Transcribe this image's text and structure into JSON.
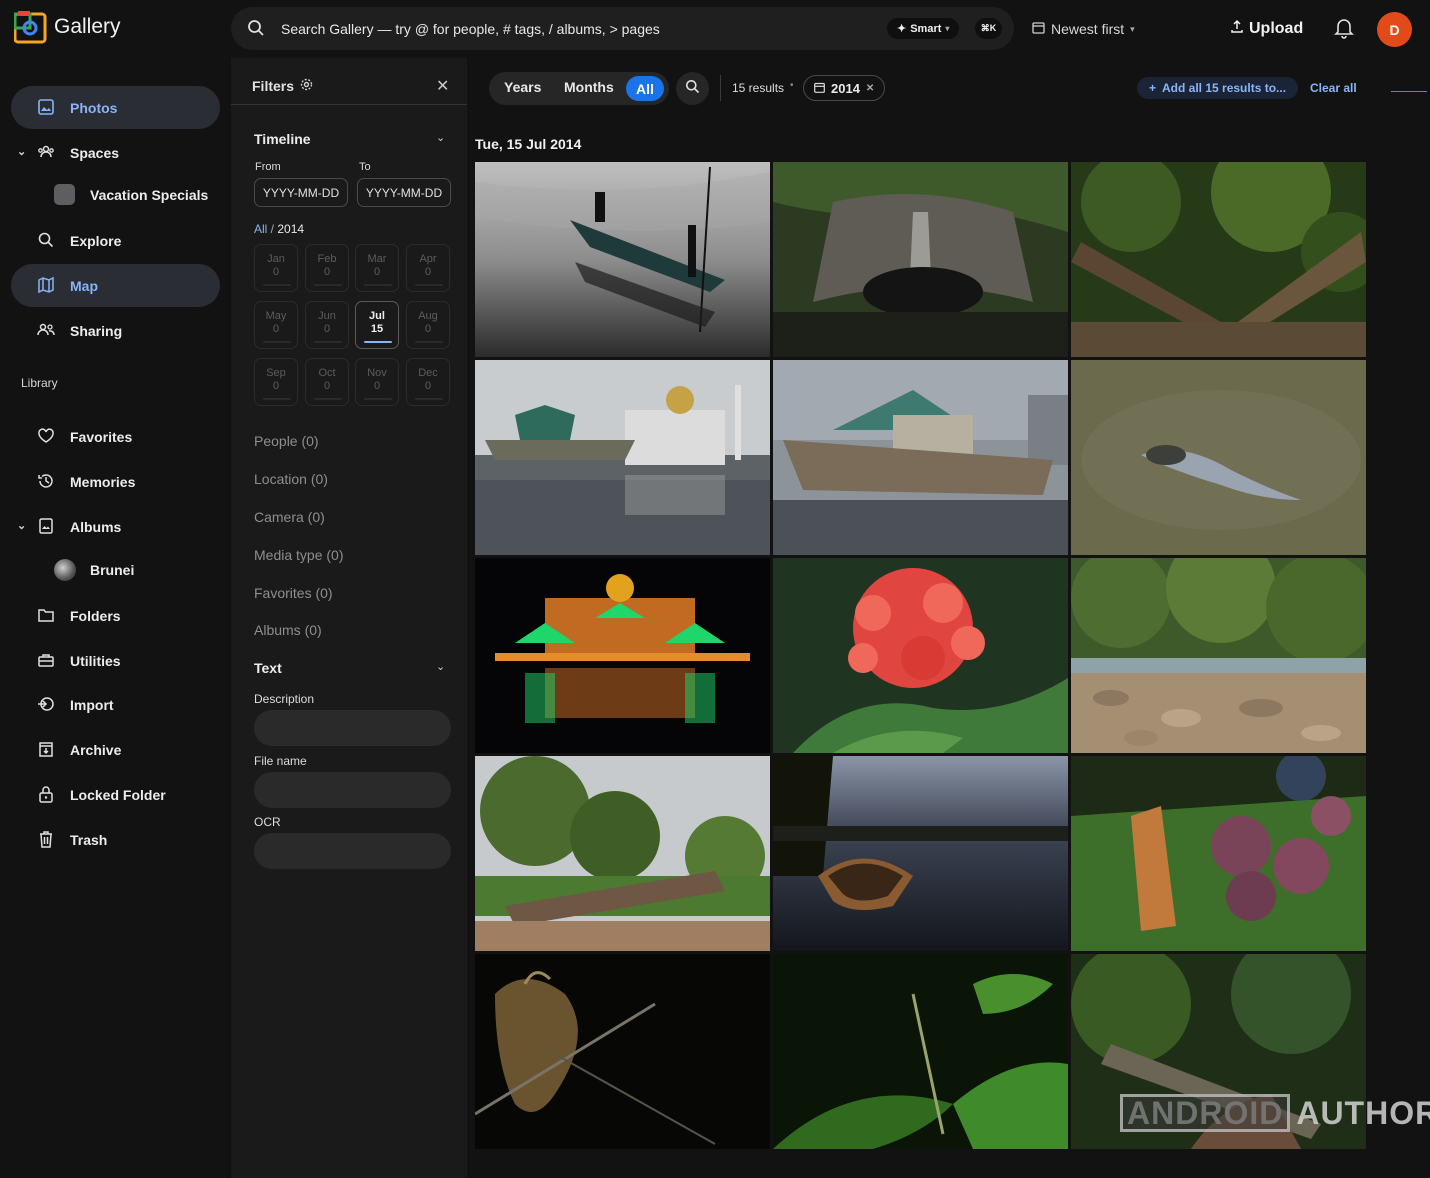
{
  "app": {
    "title": "Gallery"
  },
  "search": {
    "placeholder": "Search Gallery — try @ for people, # tags, / albums, > pages",
    "smart_label": "Smart",
    "shortcut": "⌘K"
  },
  "sort": {
    "label": "Newest first"
  },
  "upload": {
    "label": "Upload"
  },
  "user": {
    "initial": "D"
  },
  "sidebar": {
    "items": [
      {
        "label": "Photos"
      },
      {
        "label": "Spaces"
      },
      {
        "label": "Vacation Specials"
      },
      {
        "label": "Explore"
      },
      {
        "label": "Map"
      },
      {
        "label": "Sharing"
      }
    ],
    "library_label": "Library",
    "library_items": [
      {
        "label": "Favorites"
      },
      {
        "label": "Memories"
      },
      {
        "label": "Albums"
      },
      {
        "label": "Brunei"
      },
      {
        "label": "Folders"
      },
      {
        "label": "Utilities"
      },
      {
        "label": "Import"
      },
      {
        "label": "Archive"
      },
      {
        "label": "Locked Folder"
      },
      {
        "label": "Trash"
      }
    ]
  },
  "filters": {
    "title": "Filters",
    "timeline": {
      "title": "Timeline",
      "from_label": "From",
      "to_label": "To",
      "from_placeholder": "YYYY-MM-DD",
      "to_placeholder": "YYYY-MM-DD",
      "crumb_all": "All",
      "crumb_sep": " / ",
      "crumb_year": "2014",
      "months": [
        {
          "name": "Jan",
          "count": "0"
        },
        {
          "name": "Feb",
          "count": "0"
        },
        {
          "name": "Mar",
          "count": "0"
        },
        {
          "name": "Apr",
          "count": "0"
        },
        {
          "name": "May",
          "count": "0"
        },
        {
          "name": "Jun",
          "count": "0"
        },
        {
          "name": "Jul",
          "count": "15"
        },
        {
          "name": "Aug",
          "count": "0"
        },
        {
          "name": "Sep",
          "count": "0"
        },
        {
          "name": "Oct",
          "count": "0"
        },
        {
          "name": "Nov",
          "count": "0"
        },
        {
          "name": "Dec",
          "count": "0"
        }
      ]
    },
    "rows": [
      {
        "label": "People (0)"
      },
      {
        "label": "Location (0)"
      },
      {
        "label": "Camera (0)"
      },
      {
        "label": "Media type (0)"
      },
      {
        "label": "Favorites (0)"
      },
      {
        "label": "Albums (0)"
      }
    ],
    "text": {
      "title": "Text",
      "description_label": "Description",
      "filename_label": "File name",
      "ocr_label": "OCR"
    }
  },
  "toolbar": {
    "years": "Years",
    "months": "Months",
    "all": "All",
    "results": "15 results",
    "chip_year": "2014",
    "add_all": "Add all 15 results to...",
    "clear_all": "Clear all"
  },
  "main": {
    "date_heading": "Tue, 15 Jul 2014"
  },
  "watermark": {
    "box": "ANDROID",
    "text": "AUTHORITY"
  },
  "colors": {
    "accent": "#8ab4f8",
    "primary": "#1a73e8",
    "avatar": "#e24b19"
  }
}
